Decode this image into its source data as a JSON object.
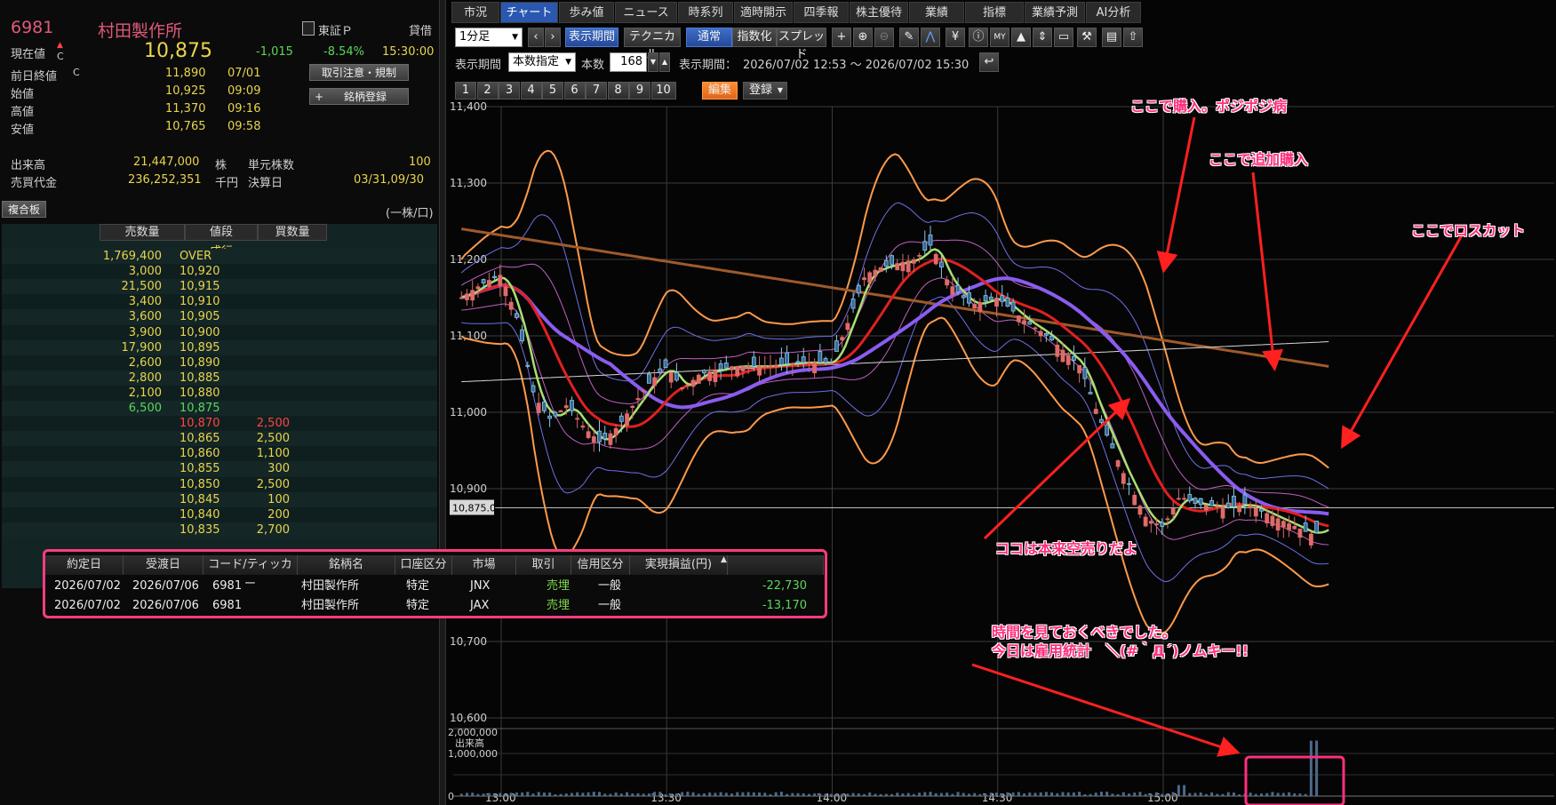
{
  "quote": {
    "code": "6981",
    "name": "村田製作所",
    "market": "東証Ｐ",
    "lending": "貸借",
    "price_label": "現在値",
    "price_flag": "C",
    "price": "10,875",
    "change": "-1,015",
    "change_pct": "-8.54%",
    "time": "15:30:00",
    "prev_label": "前日終値",
    "prev_flag": "C",
    "prev_value": "11,890",
    "prev_date": "07/01",
    "open_label": "始値",
    "open_value": "10,925",
    "open_time": "09:09",
    "high_label": "高値",
    "high_value": "11,370",
    "high_time": "09:16",
    "low_label": "安値",
    "low_value": "10,765",
    "low_time": "09:58",
    "btn_rules": "取引注意・規制",
    "btn_register": "銘柄登録",
    "volume_label": "出来高",
    "volume_value": "21,447,000",
    "volume_unit": "株",
    "unit_label": "単元株数",
    "unit_value": "100",
    "turnover_label": "売買代金",
    "turnover_value": "236,252,351",
    "turnover_unit": "千円",
    "settle_label": "決算日",
    "settle_value": "03/31,09/30"
  },
  "book": {
    "title": "複合板",
    "unit_note": "(一株/口)",
    "headers": [
      "売数量",
      "値段",
      "買数量"
    ],
    "market_label": "成行",
    "rows": [
      {
        "sell": "1,769,400",
        "price": "OVER",
        "buy": ""
      },
      {
        "sell": "3,000",
        "price": "10,920",
        "buy": ""
      },
      {
        "sell": "21,500",
        "price": "10,915",
        "buy": ""
      },
      {
        "sell": "3,400",
        "price": "10,910",
        "buy": ""
      },
      {
        "sell": "3,600",
        "price": "10,905",
        "buy": ""
      },
      {
        "sell": "3,900",
        "price": "10,900",
        "buy": ""
      },
      {
        "sell": "17,900",
        "price": "10,895",
        "buy": ""
      },
      {
        "sell": "2,600",
        "price": "10,890",
        "buy": ""
      },
      {
        "sell": "2,800",
        "price": "10,885",
        "buy": ""
      },
      {
        "sell": "2,100",
        "price": "10,880",
        "buy": ""
      },
      {
        "sell": "6,500",
        "price": "10,875",
        "buy": ""
      },
      {
        "sell": "",
        "price": "10,870",
        "buy": "2,500"
      },
      {
        "sell": "",
        "price": "10,865",
        "buy": "2,500"
      },
      {
        "sell": "",
        "price": "10,860",
        "buy": "1,100"
      },
      {
        "sell": "",
        "price": "10,855",
        "buy": "300"
      },
      {
        "sell": "",
        "price": "10,850",
        "buy": "2,500"
      },
      {
        "sell": "",
        "price": "10,845",
        "buy": "100"
      },
      {
        "sell": "",
        "price": "10,840",
        "buy": "200"
      },
      {
        "sell": "",
        "price": "10,835",
        "buy": "2,700"
      }
    ]
  },
  "tabs": [
    "市況",
    "チャート",
    "歩み値",
    "ニュース",
    "時系列",
    "適時開示",
    "四季報",
    "株主優待",
    "業績",
    "指標",
    "業績予測",
    "AI分析"
  ],
  "toolbar": {
    "interval": "1分足",
    "prev": "‹",
    "next": "›",
    "period_btn": "表示期間",
    "tech_btn": "テクニカル",
    "mode_normal": "通常",
    "mode_index": "指数化",
    "mode_spread": "スプレッド",
    "period_label": "表示期間",
    "period_select": "本数指定",
    "count_label": "本数",
    "count_value": "168",
    "range_label": "表示期間：",
    "range_value": "2026/07/02 12:53 ～ 2026/07/02 15:30",
    "nums": [
      "1",
      "2",
      "3",
      "4",
      "5",
      "6",
      "7",
      "8",
      "9",
      "10"
    ],
    "edit_btn": "編集",
    "reg_btn": "登録"
  },
  "trades": {
    "headers": [
      "約定日",
      "受渡日",
      "コード/ティッカー",
      "銘柄名",
      "口座区分",
      "市場",
      "取引",
      "信用区分",
      "実現損益(円)"
    ],
    "rows": [
      [
        "2026/07/02",
        "2026/07/06",
        "6981",
        "村田製作所",
        "特定",
        "JNX",
        "売埋",
        "一般",
        "-22,730"
      ],
      [
        "2026/07/02",
        "2026/07/06",
        "6981",
        "村田製作所",
        "特定",
        "JAX",
        "売埋",
        "一般",
        "-13,170"
      ]
    ]
  },
  "annotations": {
    "buy": "ここで購入。ポジポジ病",
    "add": "ここで追加購入",
    "cut": "ここでロスカット",
    "short": "ココは本来空売りだよ",
    "time1": "時間を見ておくべきでした。",
    "time2": "今日は雇用統計　＼(#｀Д´)ノムキー!!"
  },
  "chart_data": {
    "type": "candlestick",
    "interval": "1分足",
    "y_ticks": [
      "11,400",
      "11,300",
      "11,200",
      "11,100",
      "11,000",
      "10,900",
      "10,700",
      "10,600"
    ],
    "ylim": [
      10600,
      11400
    ],
    "x_ticks": [
      "13:00",
      "13:30",
      "14:00",
      "14:30",
      "15:00"
    ],
    "last_price_label": "10,875.0",
    "volume_label": "出来高",
    "volume_ticks": [
      "2,000,000",
      "1,000,000",
      "0"
    ],
    "close_path": [
      [
        12.88,
        11150
      ],
      [
        12.95,
        11170
      ],
      [
        13.0,
        11180
      ],
      [
        13.05,
        11120
      ],
      [
        13.1,
        11020
      ],
      [
        13.15,
        10990
      ],
      [
        13.2,
        11010
      ],
      [
        13.25,
        10980
      ],
      [
        13.3,
        10960
      ],
      [
        13.35,
        10980
      ],
      [
        13.45,
        11040
      ],
      [
        13.5,
        11060
      ],
      [
        13.55,
        11030
      ],
      [
        13.6,
        11050
      ],
      [
        13.7,
        11060
      ],
      [
        13.8,
        11060
      ],
      [
        13.9,
        11065
      ],
      [
        14.0,
        11065
      ],
      [
        14.05,
        11120
      ],
      [
        14.1,
        11180
      ],
      [
        14.15,
        11190
      ],
      [
        14.25,
        11200
      ],
      [
        14.3,
        11220
      ],
      [
        14.35,
        11170
      ],
      [
        14.42,
        11140
      ],
      [
        14.5,
        11150
      ],
      [
        14.58,
        11120
      ],
      [
        14.65,
        11100
      ],
      [
        14.75,
        11060
      ],
      [
        14.8,
        11000
      ],
      [
        14.88,
        10920
      ],
      [
        14.95,
        10860
      ],
      [
        15.0,
        10850
      ],
      [
        15.05,
        10890
      ],
      [
        15.1,
        10880
      ],
      [
        15.2,
        10875
      ],
      [
        15.25,
        10880
      ],
      [
        15.35,
        10860
      ],
      [
        15.45,
        10840
      ],
      [
        15.5,
        10850
      ]
    ]
  }
}
